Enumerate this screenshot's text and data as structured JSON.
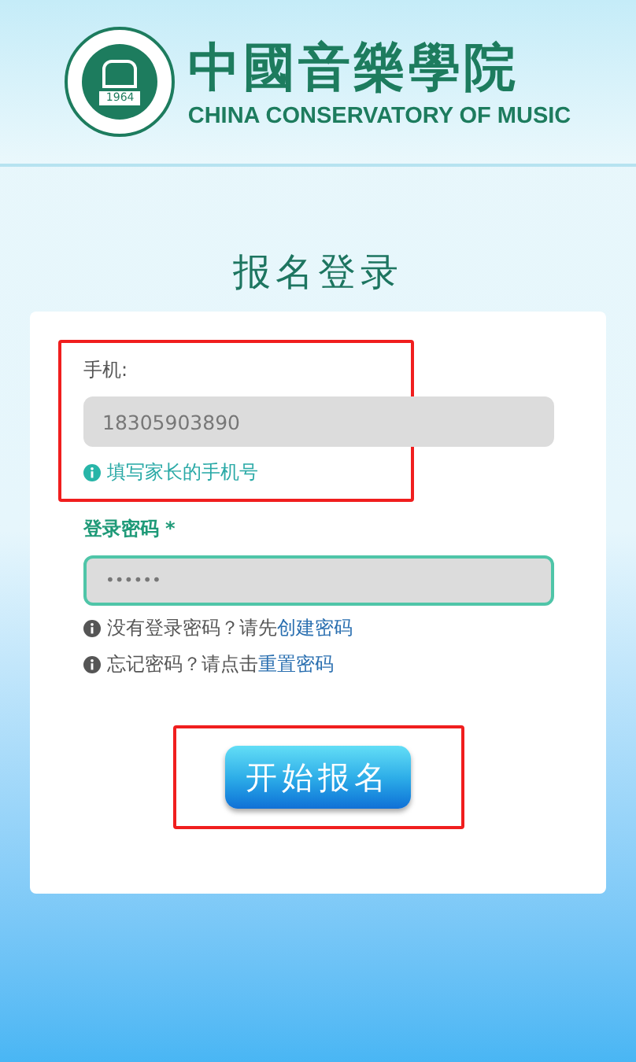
{
  "header": {
    "emblem_year": "1964",
    "title_cn": "中國音樂學院",
    "title_en": "CHINA CONSERVATORY OF MUSIC"
  },
  "page_title": "报名登录",
  "phone": {
    "label": "手机:",
    "value": "18305903890",
    "hint": "填写家长的手机号",
    "highlighted": true
  },
  "password": {
    "label": "登录密码",
    "required_mark": "*",
    "value": "••••••",
    "focused": true
  },
  "help": [
    {
      "text": "没有登录密码？请先",
      "link": "创建密码"
    },
    {
      "text": "忘记密码？请点击",
      "link": "重置密码"
    }
  ],
  "submit": {
    "label": "开始报名",
    "highlighted": true
  }
}
